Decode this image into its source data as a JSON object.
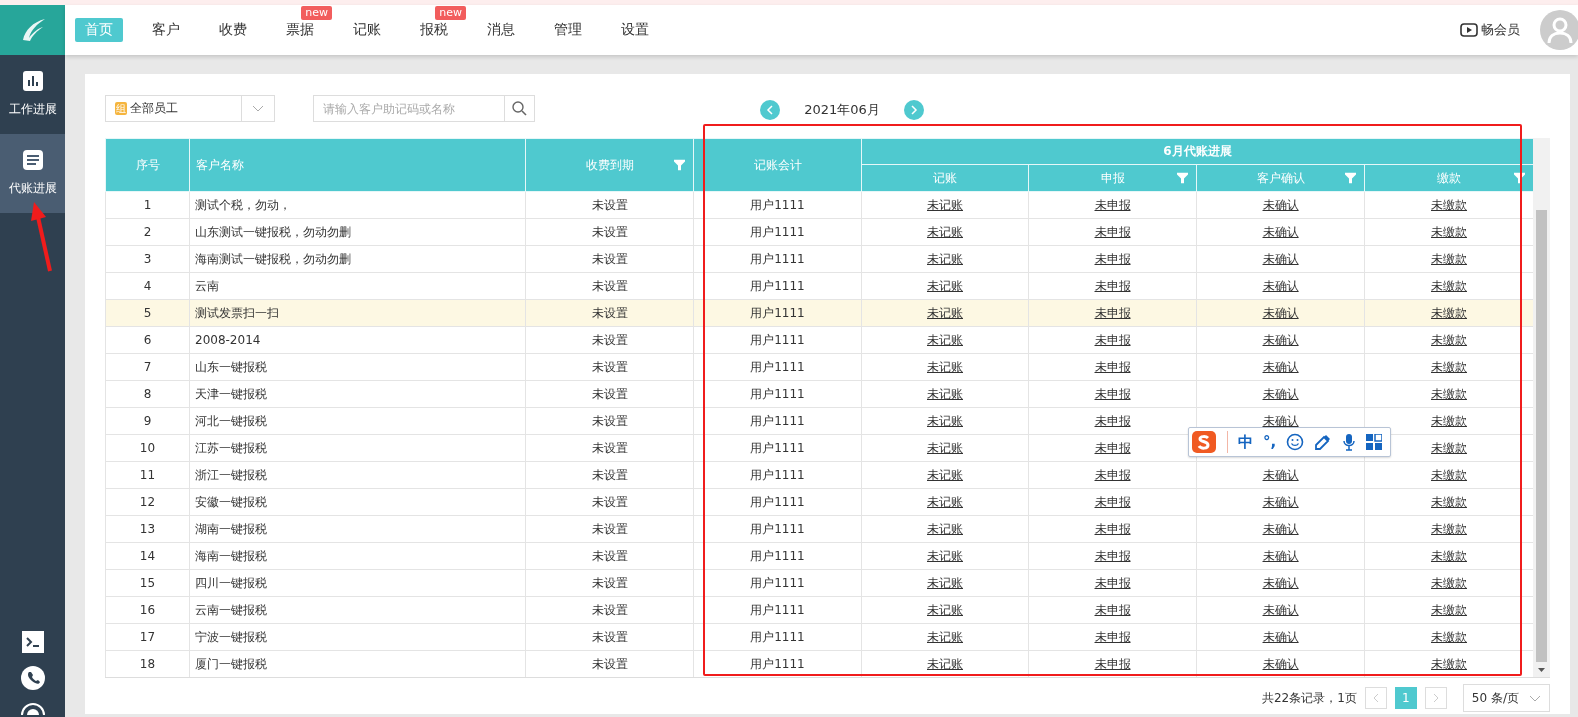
{
  "sidebar": {
    "items": [
      {
        "label": "工作进展",
        "selected": false
      },
      {
        "label": "代账进展",
        "selected": true
      }
    ]
  },
  "nav": {
    "items": [
      {
        "label": "首页",
        "selected": true
      },
      {
        "label": "客户",
        "selected": false
      },
      {
        "label": "收费",
        "selected": false
      },
      {
        "label": "票据",
        "selected": false,
        "badge": "new"
      },
      {
        "label": "记账",
        "selected": false
      },
      {
        "label": "报税",
        "selected": false,
        "badge": "new"
      },
      {
        "label": "消息",
        "selected": false
      },
      {
        "label": "管理",
        "selected": false
      },
      {
        "label": "设置",
        "selected": false
      }
    ],
    "member": "畅会员"
  },
  "filters": {
    "staff": {
      "tag": "组",
      "value": "全部员工"
    },
    "search": {
      "placeholder": "请输入客户助记码或名称"
    }
  },
  "month": "2021年06月",
  "table": {
    "columns": [
      {
        "label": "序号",
        "kind": "index",
        "filter": false
      },
      {
        "label": "客户名称",
        "kind": "name",
        "filter": false
      },
      {
        "label": "收费到期",
        "kind": "text",
        "filter": true
      },
      {
        "label": "记账会计",
        "kind": "text",
        "filter": false
      }
    ],
    "group": {
      "label": "6月代账进展",
      "columns": [
        {
          "label": "记账",
          "kind": "link",
          "filter": false
        },
        {
          "label": "申报",
          "kind": "link",
          "filter": true
        },
        {
          "label": "客户确认",
          "kind": "link",
          "filter": true
        },
        {
          "label": "缴款",
          "kind": "link",
          "filter": true
        }
      ]
    },
    "rows": [
      {
        "highlighted": false,
        "cells": [
          "1",
          "测试个税，勿动，",
          "未设置",
          "用户1111",
          "未记账",
          "未申报",
          "未确认",
          "未缴款"
        ]
      },
      {
        "highlighted": false,
        "cells": [
          "2",
          "山东测试一键报税，勿动勿删",
          "未设置",
          "用户1111",
          "未记账",
          "未申报",
          "未确认",
          "未缴款"
        ]
      },
      {
        "highlighted": false,
        "cells": [
          "3",
          "海南测试一键报税，勿动勿删",
          "未设置",
          "用户1111",
          "未记账",
          "未申报",
          "未确认",
          "未缴款"
        ]
      },
      {
        "highlighted": false,
        "cells": [
          "4",
          "云南",
          "未设置",
          "用户1111",
          "未记账",
          "未申报",
          "未确认",
          "未缴款"
        ]
      },
      {
        "highlighted": true,
        "cells": [
          "5",
          "测试发票扫一扫",
          "未设置",
          "用户1111",
          "未记账",
          "未申报",
          "未确认",
          "未缴款"
        ]
      },
      {
        "highlighted": false,
        "cells": [
          "6",
          "2008-2014",
          "未设置",
          "用户1111",
          "未记账",
          "未申报",
          "未确认",
          "未缴款"
        ]
      },
      {
        "highlighted": false,
        "cells": [
          "7",
          "山东一键报税",
          "未设置",
          "用户1111",
          "未记账",
          "未申报",
          "未确认",
          "未缴款"
        ]
      },
      {
        "highlighted": false,
        "cells": [
          "8",
          "天津一键报税",
          "未设置",
          "用户1111",
          "未记账",
          "未申报",
          "未确认",
          "未缴款"
        ]
      },
      {
        "highlighted": false,
        "cells": [
          "9",
          "河北一键报税",
          "未设置",
          "用户1111",
          "未记账",
          "未申报",
          "未确认",
          "未缴款"
        ]
      },
      {
        "highlighted": false,
        "cells": [
          "10",
          "江苏一键报税",
          "未设置",
          "用户1111",
          "未记账",
          "未申报",
          null,
          "未缴款"
        ]
      },
      {
        "highlighted": false,
        "cells": [
          "11",
          "浙江一键报税",
          "未设置",
          "用户1111",
          "未记账",
          "未申报",
          "未确认",
          "未缴款"
        ]
      },
      {
        "highlighted": false,
        "cells": [
          "12",
          "安徽一键报税",
          "未设置",
          "用户1111",
          "未记账",
          "未申报",
          "未确认",
          "未缴款"
        ]
      },
      {
        "highlighted": false,
        "cells": [
          "13",
          "湖南一键报税",
          "未设置",
          "用户1111",
          "未记账",
          "未申报",
          "未确认",
          "未缴款"
        ]
      },
      {
        "highlighted": false,
        "cells": [
          "14",
          "海南一键报税",
          "未设置",
          "用户1111",
          "未记账",
          "未申报",
          "未确认",
          "未缴款"
        ]
      },
      {
        "highlighted": false,
        "cells": [
          "15",
          "四川一键报税",
          "未设置",
          "用户1111",
          "未记账",
          "未申报",
          "未确认",
          "未缴款"
        ]
      },
      {
        "highlighted": false,
        "cells": [
          "16",
          "云南一键报税",
          "未设置",
          "用户1111",
          "未记账",
          "未申报",
          "未确认",
          "未缴款"
        ]
      },
      {
        "highlighted": false,
        "cells": [
          "17",
          "宁波一键报税",
          "未设置",
          "用户1111",
          "未记账",
          "未申报",
          "未确认",
          "未缴款"
        ]
      },
      {
        "highlighted": false,
        "cells": [
          "18",
          "厦门一键报税",
          "未设置",
          "用户1111",
          "未记账",
          "未申报",
          "未确认",
          "未缴款"
        ]
      }
    ]
  },
  "pagination": {
    "summary": "共22条记录，1页",
    "pages": [
      {
        "label": "1",
        "selected": true
      }
    ],
    "page_size": "50 条/页"
  },
  "ime_toolbar": {
    "items": [
      {
        "kind": "logo"
      },
      {
        "kind": "text",
        "label": "中"
      },
      {
        "kind": "text",
        "label": "°,"
      },
      {
        "kind": "emoji"
      },
      {
        "kind": "pen"
      },
      {
        "kind": "mic"
      },
      {
        "kind": "grid"
      }
    ]
  },
  "annotations": [
    {
      "kind": "rectangle"
    },
    {
      "kind": "arrow"
    }
  ]
}
